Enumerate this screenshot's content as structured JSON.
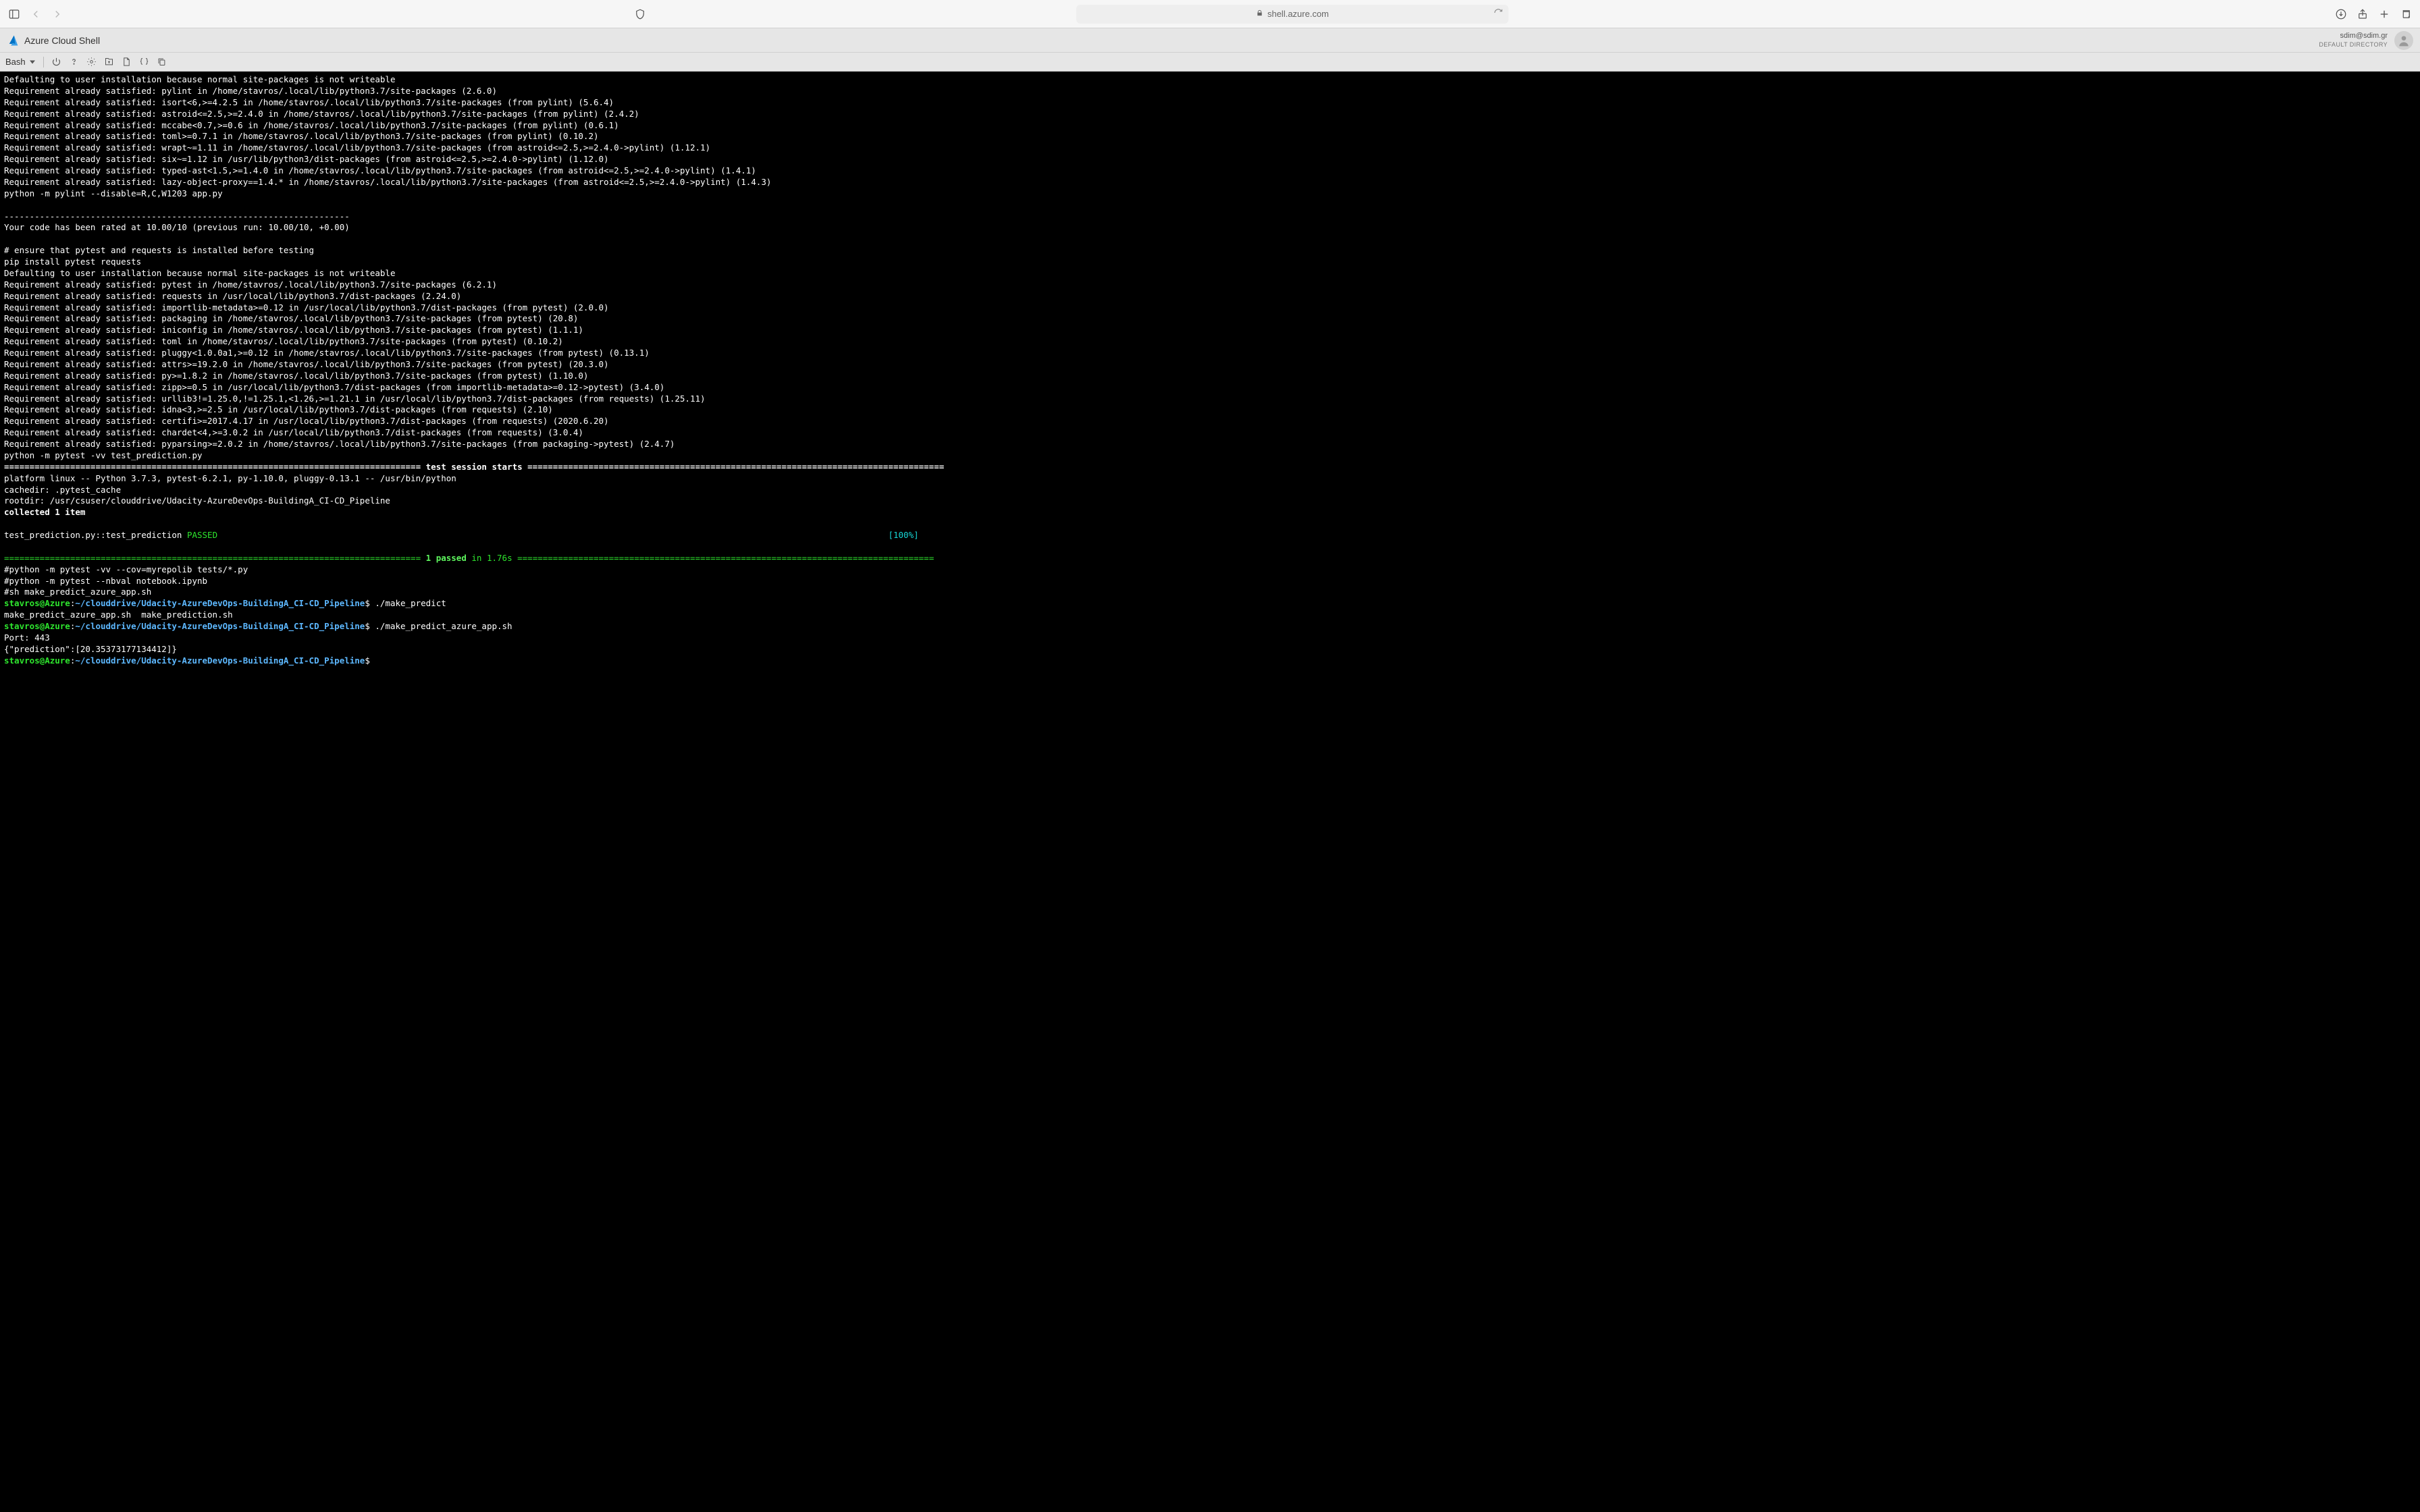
{
  "browser": {
    "address": "shell.azure.com"
  },
  "azure_header": {
    "title": "Azure Cloud Shell",
    "user_email": "sdim@sdim.gr",
    "directory": "DEFAULT DIRECTORY"
  },
  "toolbar": {
    "shell_selected": "Bash"
  },
  "terminal": {
    "lines": [
      "Defaulting to user installation because normal site-packages is not writeable",
      "Requirement already satisfied: pylint in /home/stavros/.local/lib/python3.7/site-packages (2.6.0)",
      "Requirement already satisfied: isort<6,>=4.2.5 in /home/stavros/.local/lib/python3.7/site-packages (from pylint) (5.6.4)",
      "Requirement already satisfied: astroid<=2.5,>=2.4.0 in /home/stavros/.local/lib/python3.7/site-packages (from pylint) (2.4.2)",
      "Requirement already satisfied: mccabe<0.7,>=0.6 in /home/stavros/.local/lib/python3.7/site-packages (from pylint) (0.6.1)",
      "Requirement already satisfied: toml>=0.7.1 in /home/stavros/.local/lib/python3.7/site-packages (from pylint) (0.10.2)",
      "Requirement already satisfied: wrapt~=1.11 in /home/stavros/.local/lib/python3.7/site-packages (from astroid<=2.5,>=2.4.0->pylint) (1.12.1)",
      "Requirement already satisfied: six~=1.12 in /usr/lib/python3/dist-packages (from astroid<=2.5,>=2.4.0->pylint) (1.12.0)",
      "Requirement already satisfied: typed-ast<1.5,>=1.4.0 in /home/stavros/.local/lib/python3.7/site-packages (from astroid<=2.5,>=2.4.0->pylint) (1.4.1)",
      "Requirement already satisfied: lazy-object-proxy==1.4.* in /home/stavros/.local/lib/python3.7/site-packages (from astroid<=2.5,>=2.4.0->pylint) (1.4.3)",
      "python -m pylint --disable=R,C,W1203 app.py",
      "",
      "--------------------------------------------------------------------",
      "Your code has been rated at 10.00/10 (previous run: 10.00/10, +0.00)",
      "",
      "# ensure that pytest and requests is installed before testing",
      "pip install pytest requests",
      "Defaulting to user installation because normal site-packages is not writeable",
      "Requirement already satisfied: pytest in /home/stavros/.local/lib/python3.7/site-packages (6.2.1)",
      "Requirement already satisfied: requests in /usr/local/lib/python3.7/dist-packages (2.24.0)",
      "Requirement already satisfied: importlib-metadata>=0.12 in /usr/local/lib/python3.7/dist-packages (from pytest) (2.0.0)",
      "Requirement already satisfied: packaging in /home/stavros/.local/lib/python3.7/site-packages (from pytest) (20.8)",
      "Requirement already satisfied: iniconfig in /home/stavros/.local/lib/python3.7/site-packages (from pytest) (1.1.1)",
      "Requirement already satisfied: toml in /home/stavros/.local/lib/python3.7/site-packages (from pytest) (0.10.2)",
      "Requirement already satisfied: pluggy<1.0.0a1,>=0.12 in /home/stavros/.local/lib/python3.7/site-packages (from pytest) (0.13.1)",
      "Requirement already satisfied: attrs>=19.2.0 in /home/stavros/.local/lib/python3.7/site-packages (from pytest) (20.3.0)",
      "Requirement already satisfied: py>=1.8.2 in /home/stavros/.local/lib/python3.7/site-packages (from pytest) (1.10.0)",
      "Requirement already satisfied: zipp>=0.5 in /usr/local/lib/python3.7/dist-packages (from importlib-metadata>=0.12->pytest) (3.4.0)",
      "Requirement already satisfied: urllib3!=1.25.0,!=1.25.1,<1.26,>=1.21.1 in /usr/local/lib/python3.7/dist-packages (from requests) (1.25.11)",
      "Requirement already satisfied: idna<3,>=2.5 in /usr/local/lib/python3.7/dist-packages (from requests) (2.10)",
      "Requirement already satisfied: certifi>=2017.4.17 in /usr/local/lib/python3.7/dist-packages (from requests) (2020.6.20)",
      "Requirement already satisfied: chardet<4,>=3.0.2 in /usr/local/lib/python3.7/dist-packages (from requests) (3.0.4)",
      "Requirement already satisfied: pyparsing>=2.0.2 in /home/stavros/.local/lib/python3.7/site-packages (from packaging->pytest) (2.4.7)",
      "python -m pytest -vv test_prediction.py"
    ],
    "session_header_label": " test session starts ",
    "session_info": [
      "platform linux -- Python 3.7.3, pytest-6.2.1, py-1.10.0, pluggy-0.13.1 -- /usr/bin/python",
      "cachedir: .pytest_cache",
      "rootdir: /usr/csuser/clouddrive/Udacity-AzureDevOps-BuildingA_CI-CD_Pipeline"
    ],
    "collected": "collected 1 item",
    "test_line": "test_prediction.py::test_prediction ",
    "passed_label": "PASSED",
    "percent_label": "[100%]",
    "summary_passed": "1 passed",
    "summary_time": " in 1.76s ",
    "after_lines": [
      "#python -m pytest -vv --cov=myrepolib tests/*.py",
      "#python -m pytest --nbval notebook.ipynb",
      "#sh make_predict_azure_app.sh"
    ],
    "prompt_user": "stavros@Azure",
    "prompt_path": "~/clouddrive/Udacity-AzureDevOps-BuildingA_CI-CD_Pipeline",
    "cmd1": "./make_predict",
    "completion_line": "make_predict_azure_app.sh  make_prediction.sh",
    "cmd2": "./make_predict_azure_app.sh",
    "port_line": "Port: 443",
    "prediction_line": "{\"prediction\":[20.35373177134412]}"
  }
}
